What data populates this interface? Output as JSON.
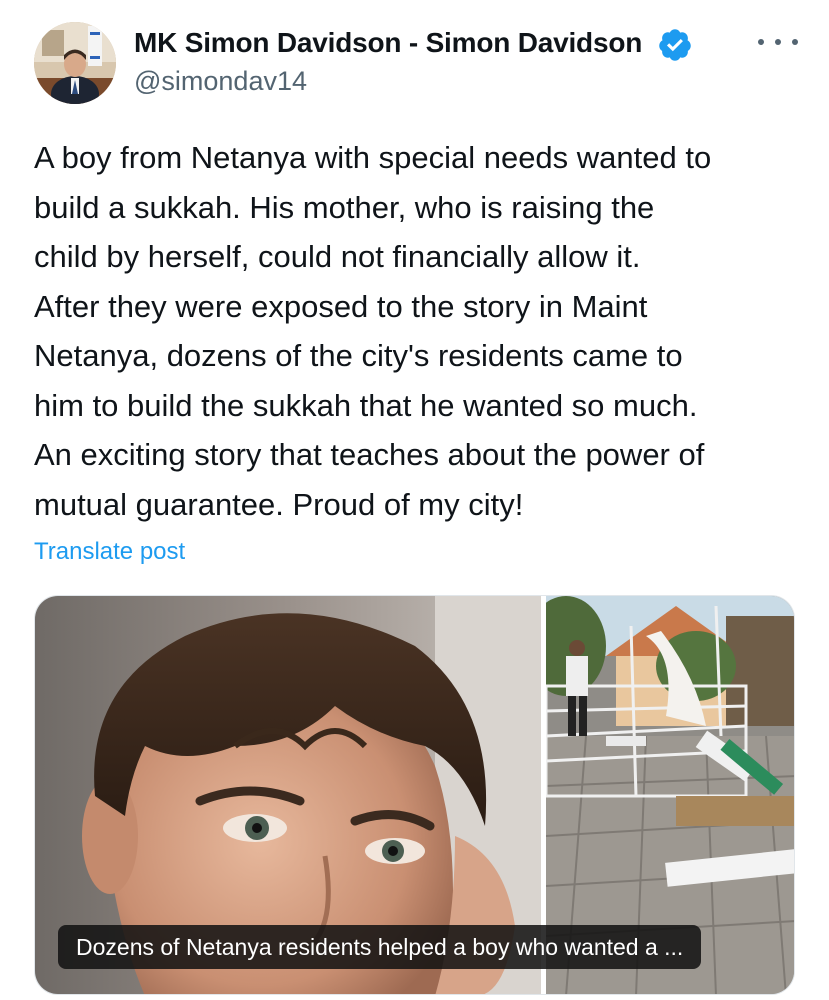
{
  "author": {
    "display_name": "MK Simon Davidson - Simon Davidson",
    "handle": "@simondav14",
    "verified": true,
    "avatar_icon": "profile-photo"
  },
  "more_icon": "more-dots-icon",
  "post": {
    "lines": [
      "A boy from Netanya with special needs wanted to",
      "build a sukkah. His mother, who is raising the",
      "child by herself, could not financially allow it.",
      "After they were exposed to the story in Maint",
      "Netanya, dozens of the city's residents came to",
      "him to build the sukkah that he wanted so much.",
      "An exciting story that teaches about the power of",
      "mutual guarantee. Proud of my city!"
    ],
    "translate_label": "Translate post"
  },
  "media": {
    "caption": "Dozens of Netanya residents helped a boy who wanted a ..."
  },
  "colors": {
    "link": "#1d9bf0",
    "verified": "#1d9bf0",
    "secondary_text": "#536471"
  }
}
